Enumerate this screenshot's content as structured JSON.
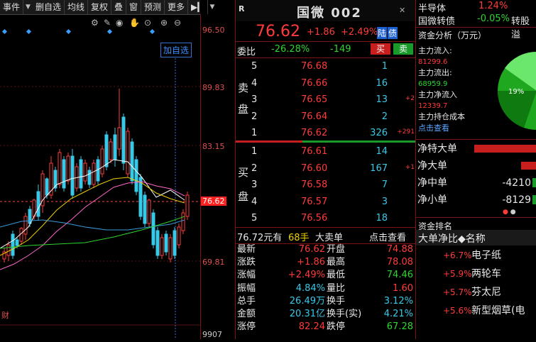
{
  "toolbar": {
    "items": [
      "事件",
      "删自选",
      "均线",
      "复权",
      "叠",
      "窗",
      "预测",
      "更多"
    ],
    "nav_icon": "play-to-end-icon"
  },
  "chart": {
    "price_ticks": [
      "96.50",
      "89.83",
      "83.15",
      "76.62",
      "69.81"
    ],
    "volume_tick": "9907",
    "add_watch_label": "加自选",
    "bottom_label": "财",
    "tool_icons": [
      "gear-icon",
      "pen-icon",
      "eye-icon",
      "hand-icon",
      "target-icon",
      "plus-circle-icon",
      "minus-circle-icon"
    ]
  },
  "stock": {
    "badge": "R",
    "name": "国微 002",
    "price": "76.62",
    "change": "+1.86",
    "change_pct": "+2.49%",
    "tags": [
      "陆",
      "债"
    ]
  },
  "order_ratio": {
    "label": "委比",
    "ratio": "-26.28%",
    "diff": "-149",
    "buy_btn": "买",
    "sell_btn": "卖"
  },
  "sell_side": {
    "label": [
      "卖",
      "盘"
    ],
    "levels": [
      {
        "lvl": "5",
        "price": "76.68",
        "vol": "1",
        "chg": ""
      },
      {
        "lvl": "4",
        "price": "76.66",
        "vol": "16",
        "chg": ""
      },
      {
        "lvl": "3",
        "price": "76.65",
        "vol": "13",
        "chg": "+2"
      },
      {
        "lvl": "2",
        "price": "76.64",
        "vol": "2",
        "chg": ""
      },
      {
        "lvl": "1",
        "price": "76.62",
        "vol": "326",
        "chg": "+291"
      }
    ]
  },
  "buy_side": {
    "label": [
      "买",
      "盘"
    ],
    "levels": [
      {
        "lvl": "1",
        "price": "76.61",
        "vol": "14",
        "chg": ""
      },
      {
        "lvl": "2",
        "price": "76.60",
        "vol": "167",
        "chg": "+1"
      },
      {
        "lvl": "3",
        "price": "76.58",
        "vol": "7",
        "chg": ""
      },
      {
        "lvl": "4",
        "price": "76.57",
        "vol": "3",
        "chg": ""
      },
      {
        "lvl": "5",
        "price": "76.56",
        "vol": "18",
        "chg": ""
      }
    ]
  },
  "last_trade": {
    "price_text": "76.72元有",
    "qty": "68手",
    "type": "大卖单",
    "link": "点击查看"
  },
  "stats": [
    {
      "k1": "最新",
      "v1": "76.62",
      "c1": "red",
      "k2": "开盘",
      "v2": "74.88",
      "c2": "red"
    },
    {
      "k1": "涨跌",
      "v1": "+1.86",
      "c1": "red",
      "k2": "最高",
      "v2": "78.08",
      "c2": "red"
    },
    {
      "k1": "涨幅",
      "v1": "+2.49%",
      "c1": "red",
      "k2": "最低",
      "v2": "74.46",
      "c2": "green"
    },
    {
      "k1": "振幅",
      "v1": "4.84%",
      "c1": "cyan",
      "k2": "量比",
      "v2": "1.60",
      "c2": "red"
    },
    {
      "k1": "总手",
      "v1": "26.49万",
      "c1": "cyan",
      "k2": "换手",
      "v2": "3.12%",
      "c2": "cyan"
    },
    {
      "k1": "金额",
      "v1": "20.31亿",
      "c1": "cyan",
      "k2": "换手(实)",
      "v2": "4.21%",
      "c2": "cyan"
    },
    {
      "k1": "涨停",
      "v1": "82.24",
      "c1": "red",
      "k2": "跌停",
      "v2": "67.28",
      "c2": "green"
    }
  ],
  "sector": {
    "rows": [
      {
        "name": "半导体",
        "pct": "1.24%",
        "color": "red"
      },
      {
        "name": "国微转债",
        "pct": "-0.05%",
        "color": "green",
        "extra": "转股溢"
      }
    ]
  },
  "fund": {
    "title": "资金分析（万元）",
    "inflow_label": "主力流入:",
    "inflow": "81299.6",
    "outflow_label": "主力流出:",
    "outflow": "68959.9",
    "net_label": "主力净流入",
    "net": "12339.7",
    "cost_label": "主力持仓成本",
    "cost_link": "点击查看",
    "pie_label": "19%"
  },
  "net_flow": [
    {
      "label": "净特大单",
      "value": "",
      "bar": "red"
    },
    {
      "label": "净大单",
      "value": "",
      "bar": "red"
    },
    {
      "label": "净中单",
      "value": "-4210",
      "bar": "green"
    },
    {
      "label": "净小单",
      "value": "-8129",
      "bar": "green"
    }
  ],
  "ranking": {
    "title": "资金排名",
    "header": "大单净比◆名称",
    "rows": [
      {
        "pct": "+6.7%",
        "name": "电子纸"
      },
      {
        "pct": "+5.9%",
        "name": "两轮车"
      },
      {
        "pct": "+5.7%",
        "name": "芬太尼"
      },
      {
        "pct": "+5.6%",
        "name": "新型烟草(电"
      }
    ]
  },
  "colors": {
    "up": "#ff3b3b",
    "down": "#2fd52f",
    "grid": "#7a1414",
    "info": "#39c9e8"
  }
}
